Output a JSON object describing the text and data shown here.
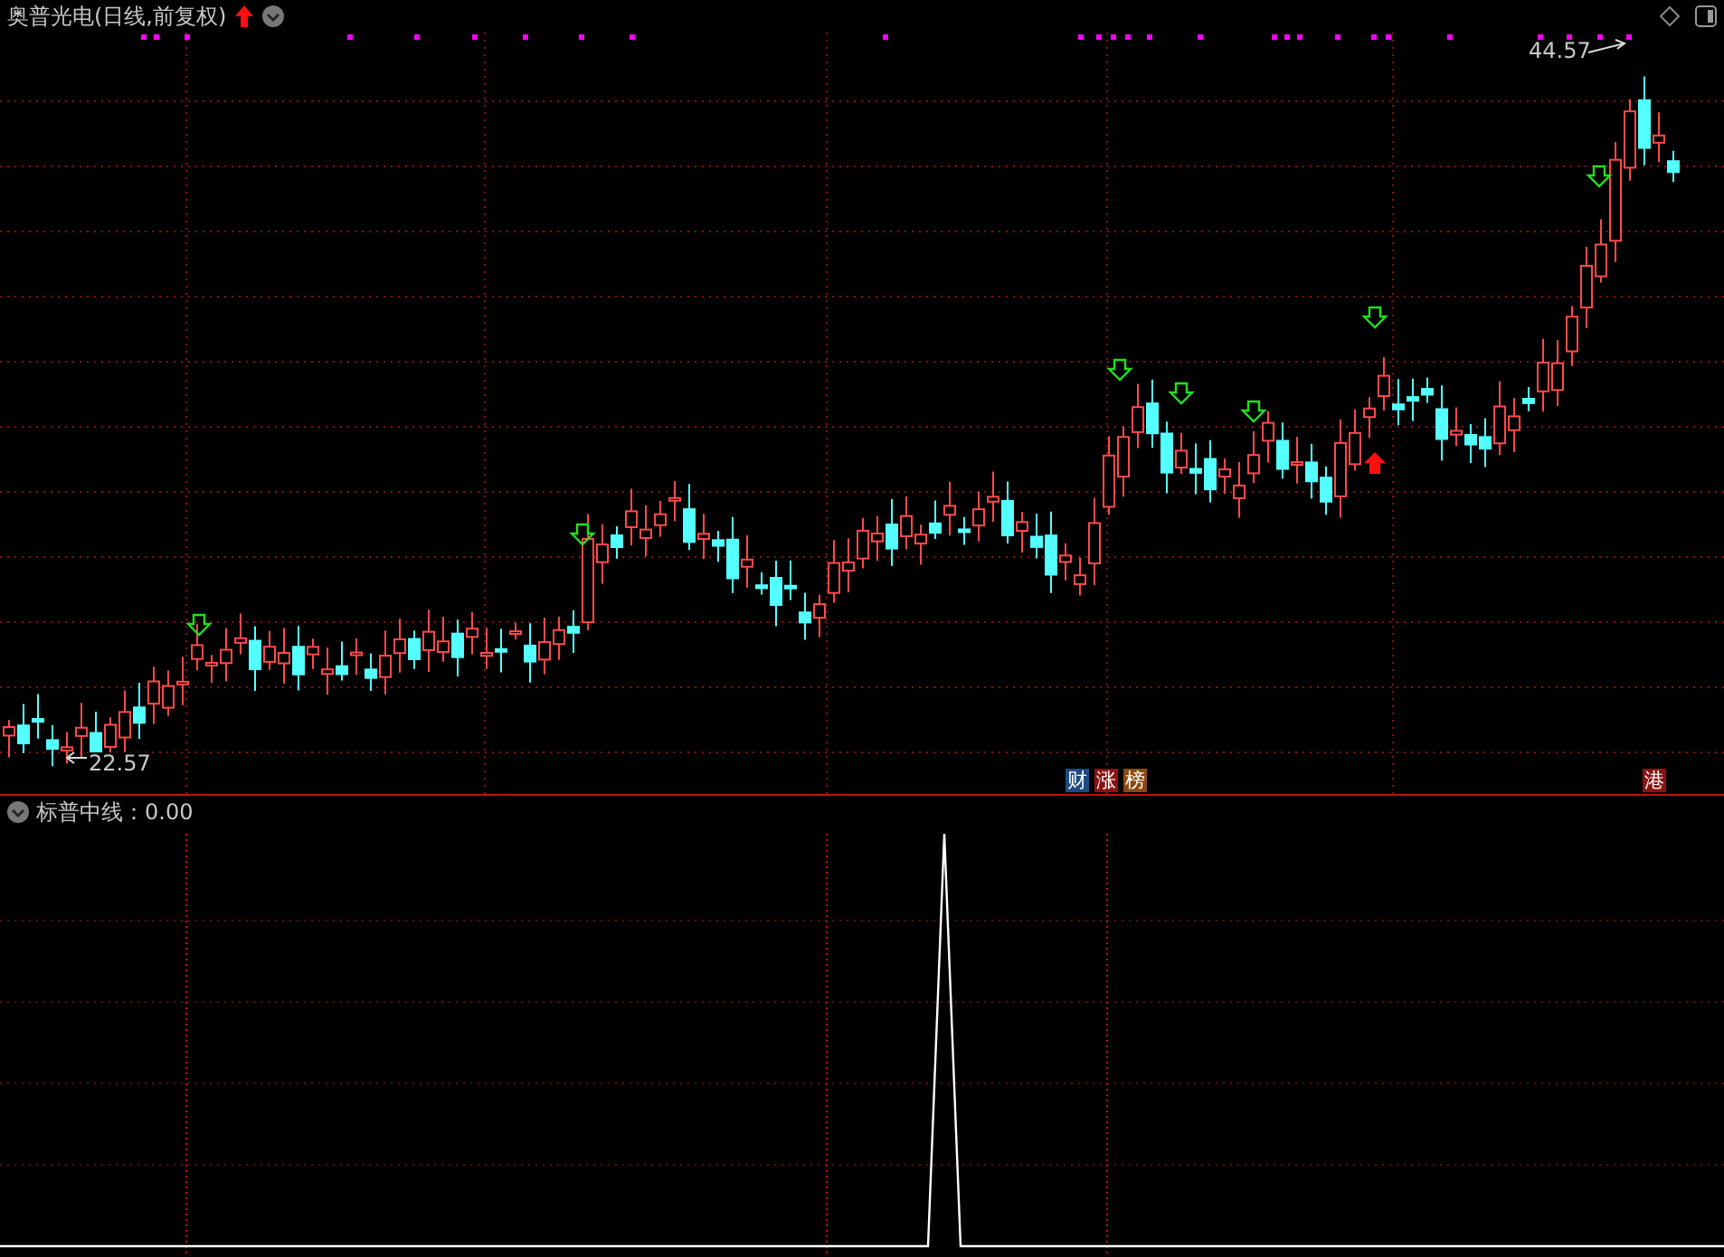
{
  "chart": {
    "title": "奥普光电(日线,前复权)",
    "high_label": "44.57",
    "low_label": "22.57",
    "badges": [
      {
        "text": "财",
        "color": "#1d4a82"
      },
      {
        "text": "涨",
        "color": "#8c1212"
      },
      {
        "text": "榜",
        "color": "#8a4a12"
      },
      {
        "text": "港",
        "color": "#8c1212"
      }
    ]
  },
  "indicator": {
    "label": "标普中线：0.00"
  }
}
